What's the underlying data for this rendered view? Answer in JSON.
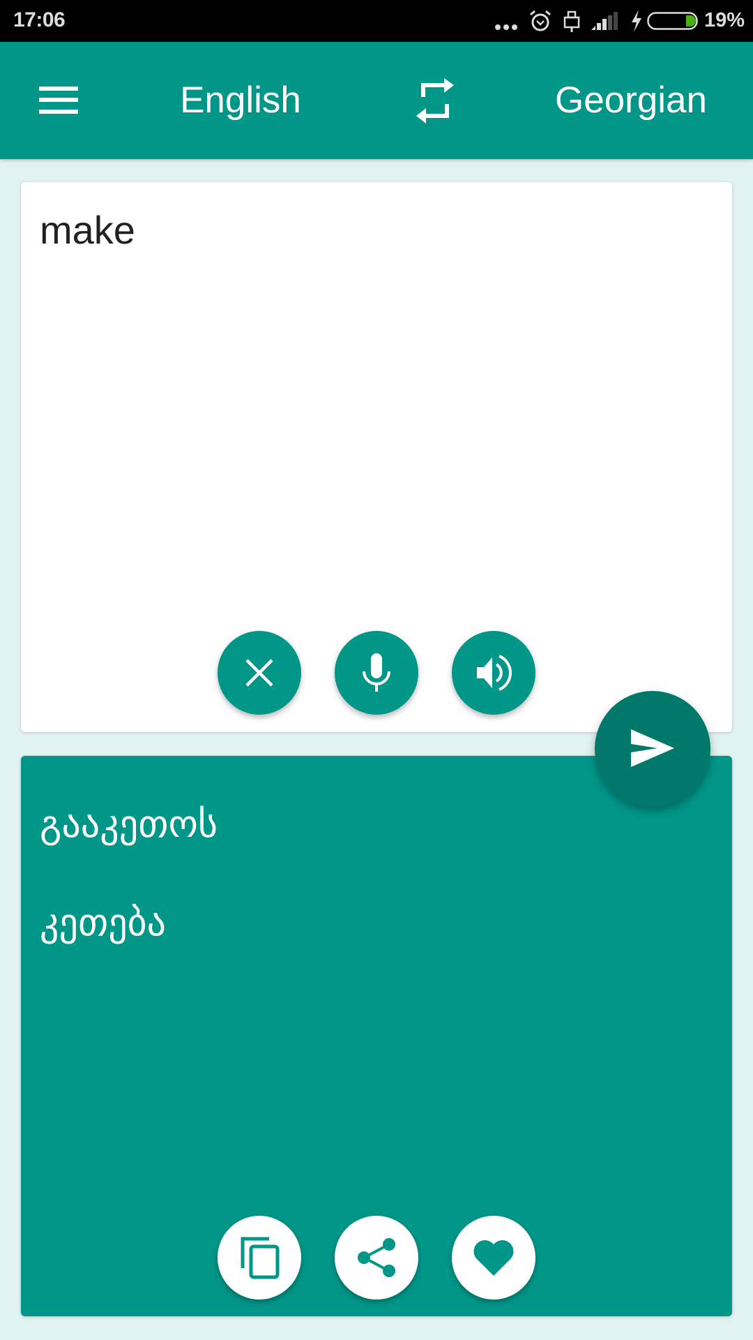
{
  "status_bar": {
    "time": "17:06",
    "battery_percent": "19%",
    "battery_level": 0.19,
    "icons": [
      "more-notifications-icon",
      "alarm-icon",
      "usb-icon",
      "signal-icon",
      "charging-icon",
      "battery-icon"
    ]
  },
  "app_bar": {
    "menu_icon": "hamburger-menu-icon",
    "source_language": "English",
    "swap_icon": "swap-languages-icon",
    "target_language": "Georgian"
  },
  "input": {
    "value": "make",
    "actions": [
      {
        "name": "clear",
        "icon": "close-icon"
      },
      {
        "name": "voice-input",
        "icon": "microphone-icon"
      },
      {
        "name": "speak",
        "icon": "speaker-icon"
      }
    ]
  },
  "translate_button": {
    "icon": "send-icon"
  },
  "output": {
    "lines": [
      "გააკეთოს",
      "კეთება"
    ],
    "actions": [
      {
        "name": "copy",
        "icon": "copy-icon"
      },
      {
        "name": "share",
        "icon": "share-icon"
      },
      {
        "name": "favorite",
        "icon": "heart-icon"
      }
    ]
  },
  "colors": {
    "primary": "#009688",
    "primary_dark": "#00796b",
    "background": "#e0f2f1",
    "battery_fill": "#4caf14"
  }
}
